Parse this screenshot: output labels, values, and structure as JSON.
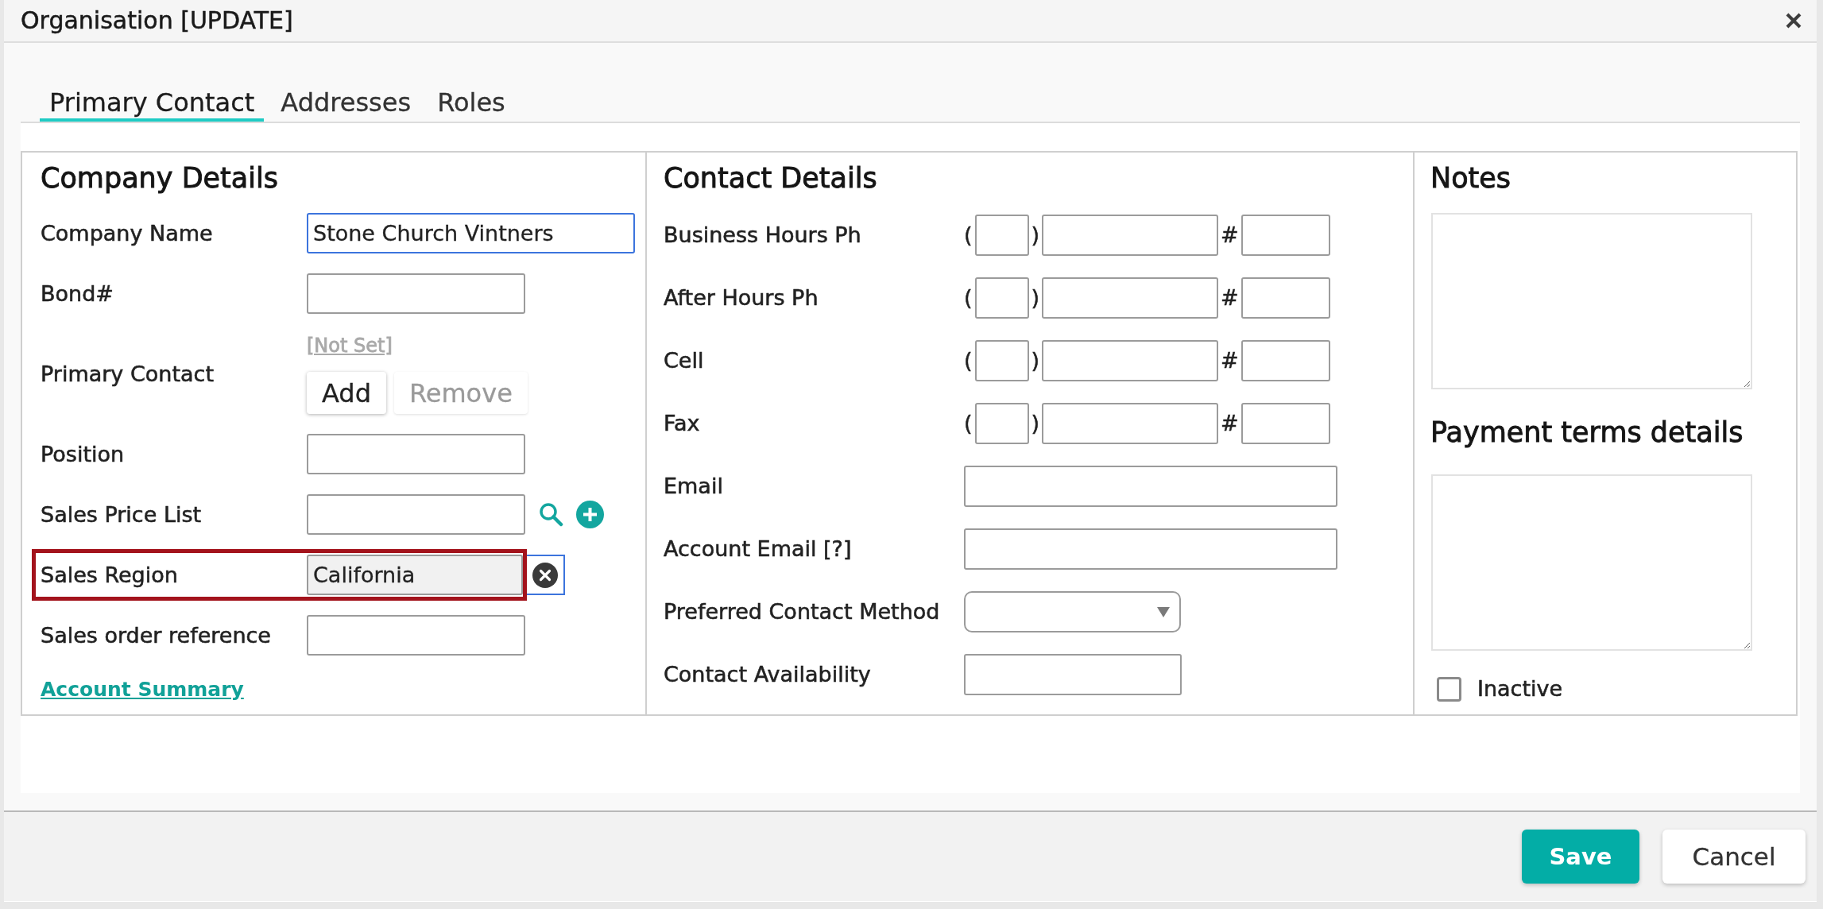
{
  "window": {
    "title": "Organisation [UPDATE]"
  },
  "tabs": [
    {
      "label": "Primary Contact",
      "selected": true
    },
    {
      "label": "Addresses",
      "selected": false
    },
    {
      "label": "Roles",
      "selected": false
    }
  ],
  "company_details": {
    "heading": "Company Details",
    "fields": [
      {
        "kind": "long_text",
        "label": "Company Name",
        "value": "Stone Church Vintners",
        "focused": true,
        "highlighted": false
      },
      {
        "kind": "text",
        "label": "Bond#",
        "focused": false,
        "highlighted": false
      },
      {
        "kind": "contact",
        "label": "Primary Contact",
        "link": "[Not Set]",
        "buttons": [
          {
            "label": "Add",
            "disabled": false
          },
          {
            "label": "Remove",
            "disabled": true
          }
        ],
        "highlighted": false
      },
      {
        "kind": "text",
        "label": "Position",
        "focused": false,
        "highlighted": false
      },
      {
        "kind": "lookup",
        "label": "Sales Price List",
        "focused": false,
        "highlighted": false
      },
      {
        "kind": "select",
        "label": "Sales Region",
        "value": "California",
        "focused": true,
        "highlighted": true
      },
      {
        "kind": "text",
        "label": "Sales order reference",
        "focused": false,
        "highlighted": false
      }
    ],
    "link": "Account Summary"
  },
  "contact_details": {
    "heading": "Contact Details",
    "fields": [
      {
        "kind": "phone",
        "label": "Business Hours Ph",
        "open": "(",
        "close": ")",
        "hash": "#"
      },
      {
        "kind": "phone",
        "label": "After Hours Ph",
        "open": "(",
        "close": ")",
        "hash": "#"
      },
      {
        "kind": "phone",
        "label": "Cell",
        "open": "(",
        "close": ")",
        "hash": "#"
      },
      {
        "kind": "phone",
        "label": "Fax",
        "open": "(",
        "close": ")",
        "hash": "#"
      },
      {
        "kind": "long_text",
        "label": "Email"
      },
      {
        "kind": "long_text",
        "label": "Account Email [?]"
      },
      {
        "kind": "dropdown",
        "label": "Preferred Contact Method"
      },
      {
        "kind": "text",
        "label": "Contact Availability"
      }
    ]
  },
  "notes_panel": {
    "notes_heading": "Notes",
    "payment_heading": "Payment terms details",
    "inactive": {
      "label": "Inactive",
      "checked": false
    }
  },
  "footer": {
    "buttons": [
      {
        "label": "Save",
        "kind": "primary"
      },
      {
        "label": "Cancel",
        "kind": "secondary"
      }
    ]
  }
}
